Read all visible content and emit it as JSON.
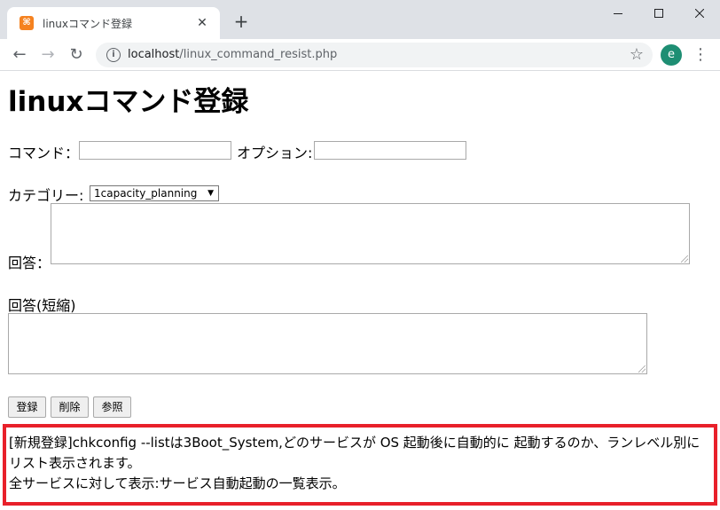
{
  "browser": {
    "tab_title": "linuxコマンド登録",
    "favicon_glyph": "⌘",
    "url_host": "localhost",
    "url_path": "/linux_command_resist.php",
    "avatar_letter": "e",
    "favicon_color": "#f58220",
    "avatar_color": "#1e8e73"
  },
  "page": {
    "heading": "linuxコマンド登録",
    "command_label": "コマンド：",
    "command_value": "",
    "option_label": "オプション:",
    "option_value": "",
    "category_label": "カテゴリー:",
    "category_selected": "1capacity_planning",
    "answer_label": "回答：",
    "answer_value": "",
    "short_answer_label": "回答(短縮)",
    "short_answer_value": "",
    "buttons": {
      "register": "登録",
      "delete": "削除",
      "browse": "参照"
    },
    "result": {
      "line1": "[新規登録]chkconfig --listは3Boot_System,どのサービスが OS 起動後に自動的に 起動するのか、ランレベル別にリスト表示されます。",
      "line2": "全サービスに対して表示:サービス自動起動の一覧表示。",
      "border_color": "#e8202a"
    }
  }
}
